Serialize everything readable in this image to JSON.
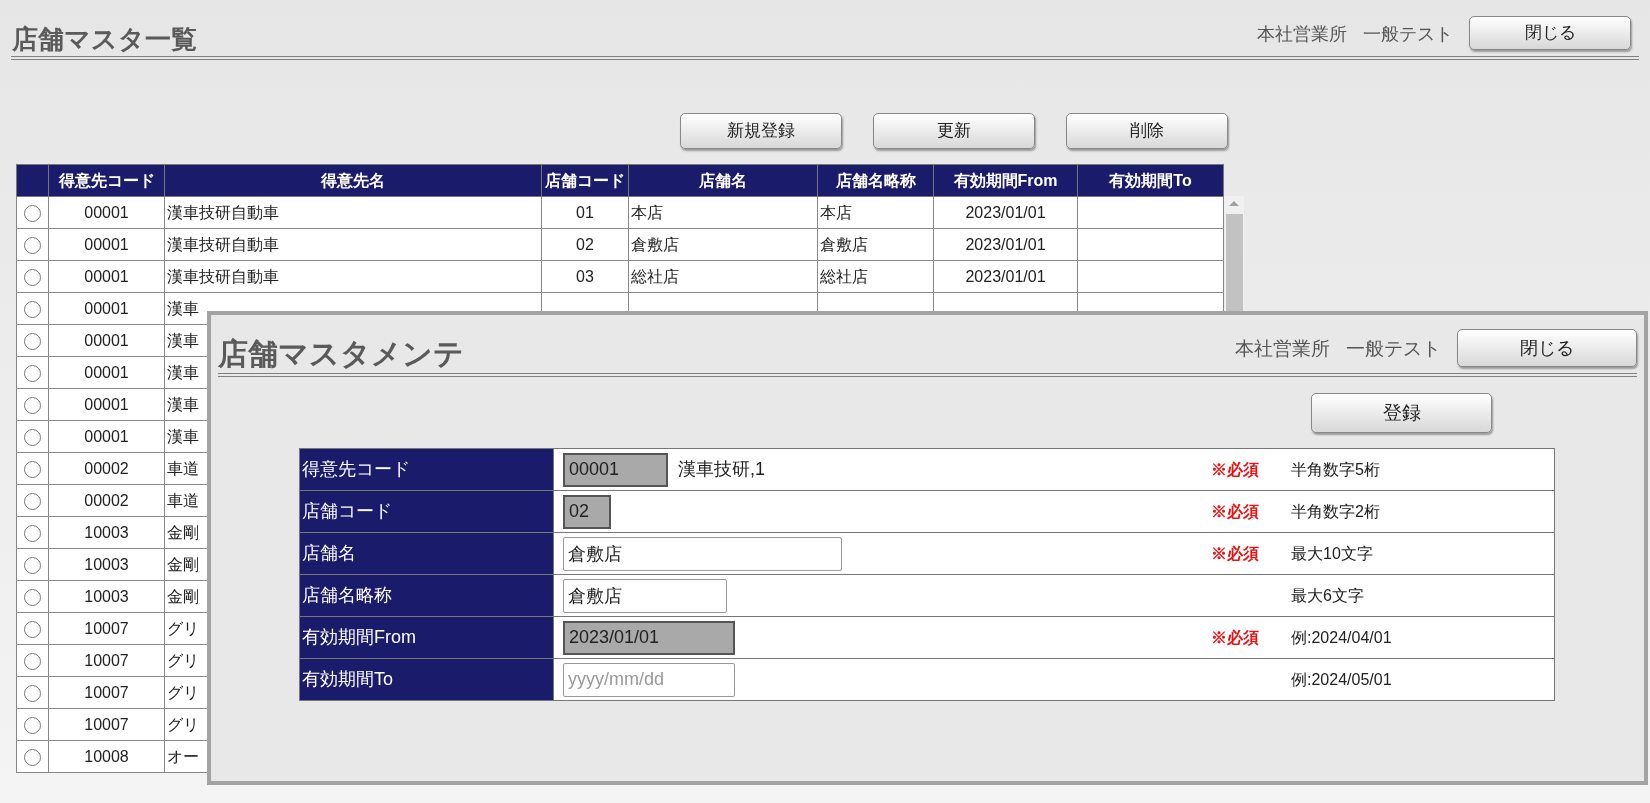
{
  "header": {
    "title": "店舗マスタ一覧",
    "office": "本社営業所",
    "user": "一般テスト",
    "close_button": "閉じる"
  },
  "actions": [
    "新規登録",
    "更新",
    "削除"
  ],
  "table": {
    "columns": [
      "得意先コード",
      "得意先名",
      "店舗コード",
      "店舗名",
      "店舗名略称",
      "有効期間From",
      "有効期間To"
    ],
    "rows": [
      {
        "selected": false,
        "cells": [
          "00001",
          "漢車技研自動車",
          "01",
          "本店",
          "本店",
          "2023/01/01"
        ]
      },
      {
        "selected": false,
        "cells": [
          "00001",
          "漢車技研自動車",
          "02",
          "倉敷店",
          "倉敷店",
          "2023/01/01"
        ]
      },
      {
        "selected": false,
        "cells": [
          "00001",
          "漢車技研自動車",
          "03",
          "総社店",
          "総社店",
          "2023/01/01"
        ]
      },
      {
        "selected": false,
        "cells": [
          "00001",
          "漢車"
        ]
      },
      {
        "selected": false,
        "cells": [
          "00001",
          "漢車"
        ]
      },
      {
        "selected": false,
        "cells": [
          "00001",
          "漢車"
        ]
      },
      {
        "selected": false,
        "cells": [
          "00001",
          "漢車"
        ]
      },
      {
        "selected": false,
        "cells": [
          "00001",
          "漢車"
        ]
      },
      {
        "selected": false,
        "cells": [
          "00002",
          "車道"
        ]
      },
      {
        "selected": false,
        "cells": [
          "00002",
          "車道"
        ]
      },
      {
        "selected": false,
        "cells": [
          "10003",
          "金剛"
        ]
      },
      {
        "selected": false,
        "cells": [
          "10003",
          "金剛"
        ]
      },
      {
        "selected": false,
        "cells": [
          "10003",
          "金剛"
        ]
      },
      {
        "selected": false,
        "cells": [
          "10007",
          "グリ"
        ]
      },
      {
        "selected": false,
        "cells": [
          "10007",
          "グリ"
        ]
      },
      {
        "selected": false,
        "cells": [
          "10007",
          "グリ"
        ]
      },
      {
        "selected": false,
        "cells": [
          "10007",
          "グリ"
        ]
      },
      {
        "selected": false,
        "cells": [
          "10008",
          "オー"
        ]
      }
    ]
  },
  "dialog": {
    "title": "店舗マスタメンテ",
    "office": "本社営業所",
    "user": "一般テスト",
    "close_button": "閉じる",
    "submit_button": "登録",
    "fields": [
      {
        "label": "得意先コード",
        "value": "00001",
        "disabled": true,
        "extra": "漢車技研,1",
        "required": "※必須",
        "note": "半角数字5桁"
      },
      {
        "label": "店舗コード",
        "value": "02",
        "disabled": true,
        "required": "※必須",
        "note": "半角数字2桁"
      },
      {
        "label": "店舗名",
        "value": "倉敷店",
        "disabled": false,
        "required": "※必須",
        "note": "最大10文字"
      },
      {
        "label": "店舗名略称",
        "value": "倉敷店",
        "disabled": false,
        "note": "最大6文字"
      },
      {
        "label": "有効期間From",
        "value": "2023/01/01",
        "disabled": true,
        "required": "※必須",
        "note": "例:2024/04/01"
      },
      {
        "label": "有効期間To",
        "placeholder": "yyyy/mm/dd",
        "disabled": false,
        "note": "例:2024/05/01"
      }
    ]
  }
}
